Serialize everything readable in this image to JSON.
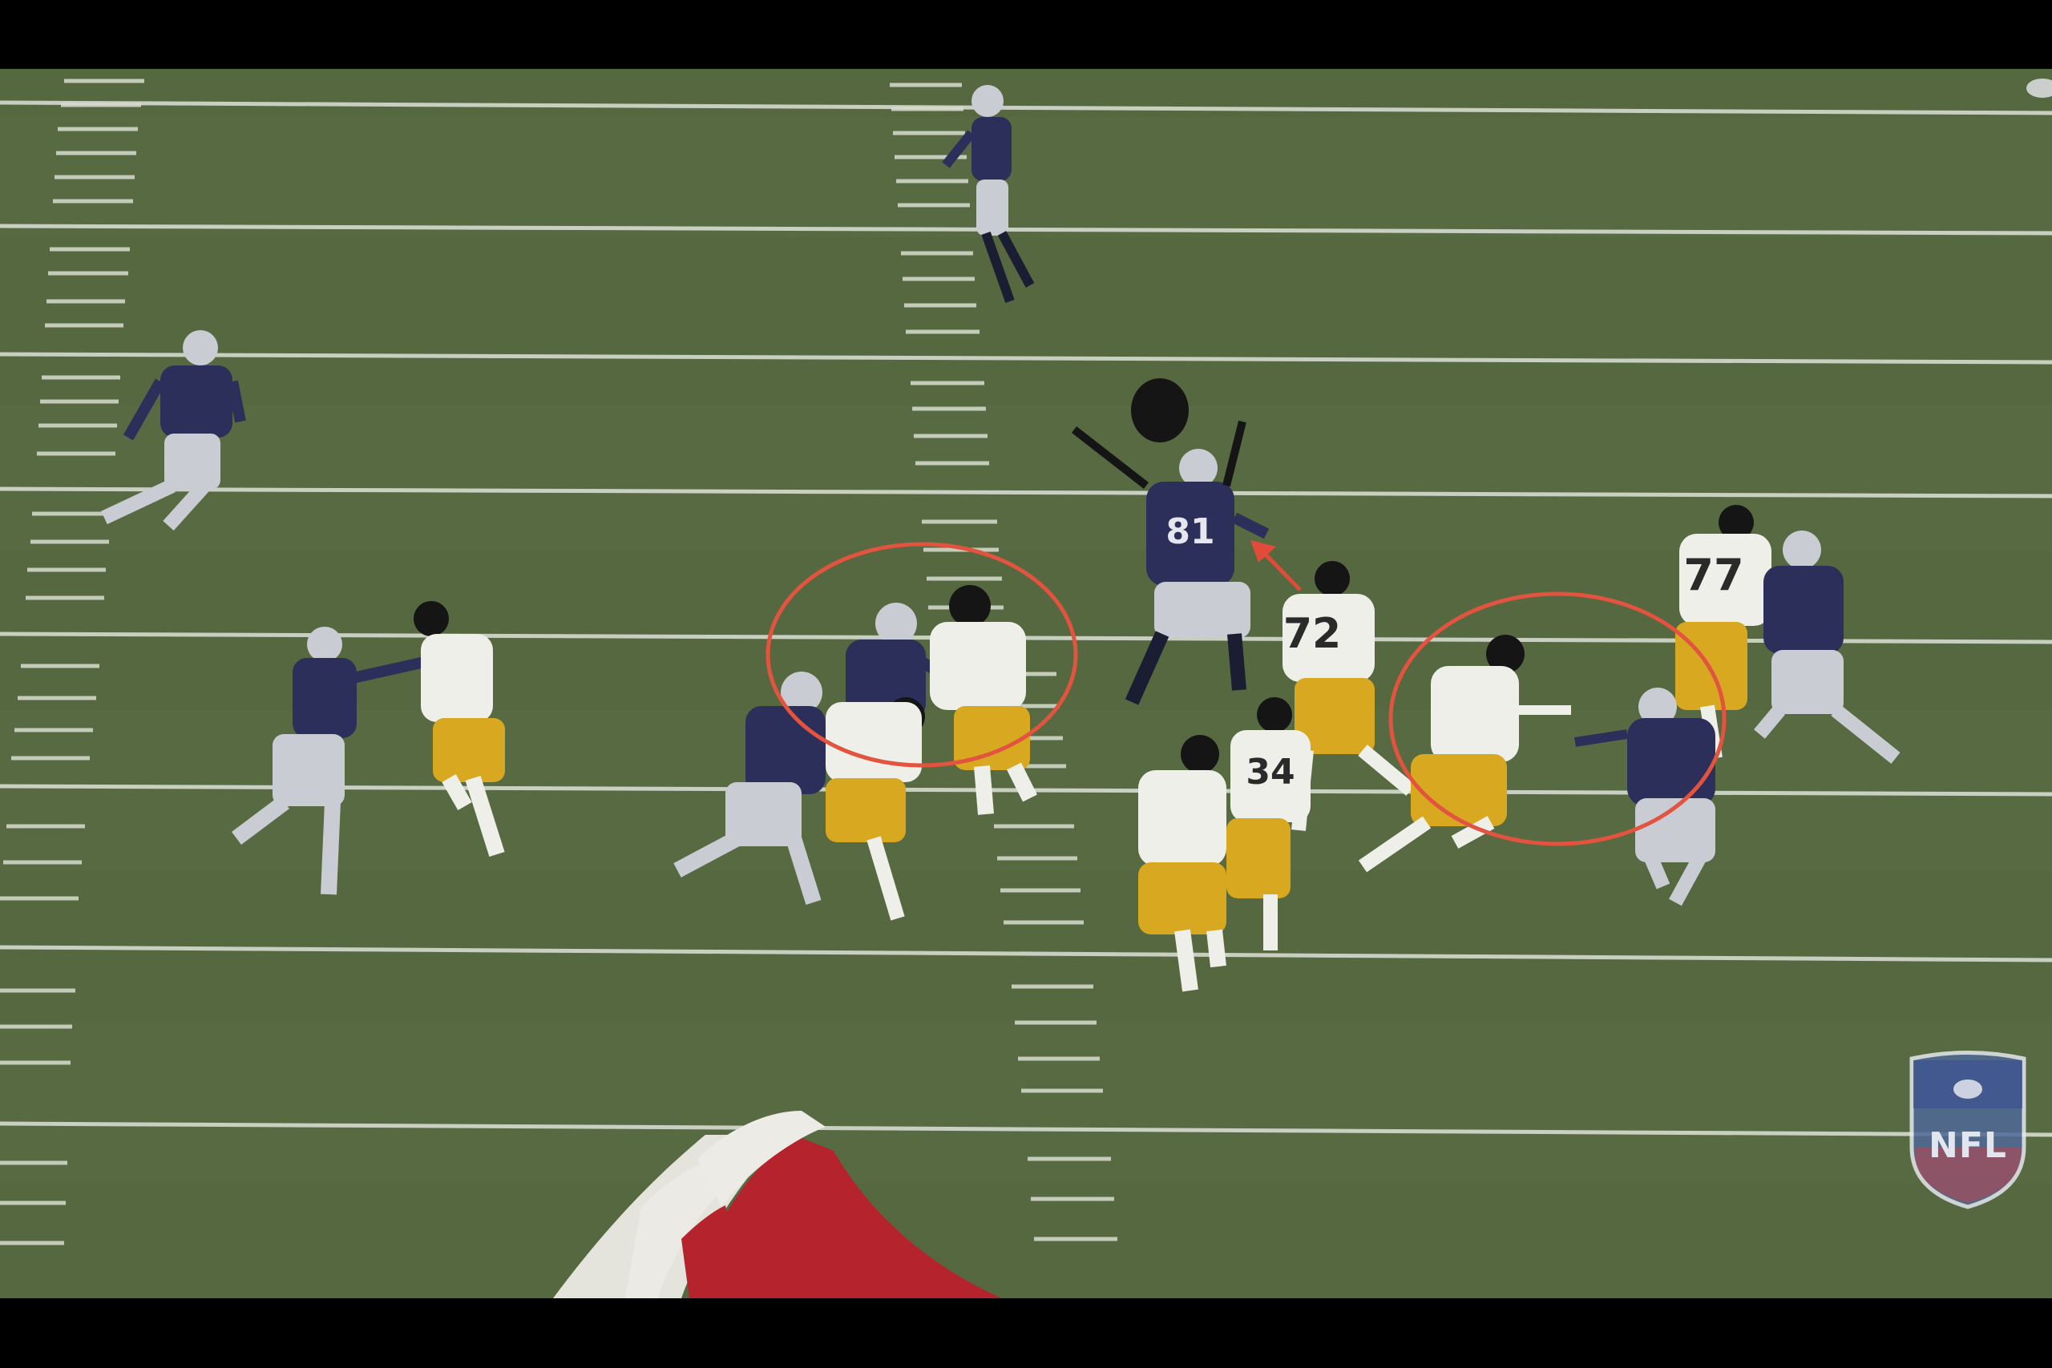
{
  "scene": {
    "description_free": true,
    "colors": {
      "turf": "#55683f",
      "yard_line": "#d9ddd0",
      "home_jersey": "#2c2f5a",
      "away_jersey": "#efefe9",
      "away_pants": "#d7a820",
      "helmet_black": "#151515",
      "helmet_silver": "#c9ccd2",
      "annotation_circle": "#e2543f",
      "annotation_arrow": "#e24a3a",
      "end_logo_red": "#b5242d",
      "end_logo_white": "#ecebe6"
    }
  },
  "players": {
    "jersey_72": "72",
    "jersey_77": "77",
    "jersey_34": "34",
    "jersey_81": "81"
  },
  "annotations": {
    "circle_count": 2,
    "arrow_count": 1
  },
  "watermark": {
    "logo_text": "NFL",
    "logo_icon": "nfl-shield-icon"
  }
}
